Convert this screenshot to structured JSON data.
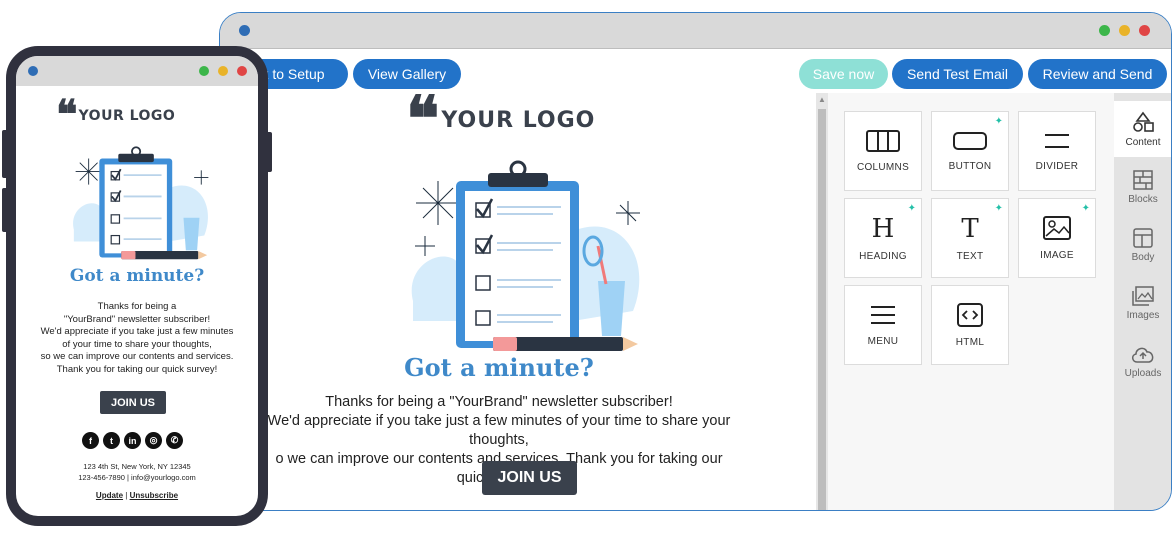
{
  "toolbar": {
    "back_label": "k to Setup",
    "gallery_label": "View Gallery",
    "save_label": "Save now",
    "test_label": "Send Test Email",
    "review_label": "Review and Send"
  },
  "email": {
    "logo_quote": "❝",
    "logo_text": "YOUR LOGO",
    "headline": "Got a minute?",
    "body_lines_desktop": [
      "Thanks for being a \"YourBrand\" newsletter subscriber!",
      "We'd appreciate if you take just a few minutes of your time to share your thoughts,",
      "o we can improve our contents and services. Thank you for taking our quick survey!"
    ],
    "body_lines_mobile": [
      "Thanks for being a",
      "\"YourBrand\" newsletter subscriber!",
      "We'd appreciate if you take just a few minutes",
      "of your time to share your thoughts,",
      "so we can improve our contents and services.",
      "Thank you for taking our quick survey!"
    ],
    "join_label": "JOIN US",
    "address_line1": "123 4th St, New York, NY 12345",
    "address_line2": "123-456-7890  |  info@yourlogo.com",
    "link_update": "Update",
    "link_separator": "|",
    "link_unsubscribe": "Unsubscribe",
    "social_icons": [
      "facebook-icon",
      "twitter-icon",
      "linkedin-icon",
      "instagram-icon",
      "whatsapp-icon"
    ]
  },
  "tools": [
    {
      "label": "COLUMNS",
      "icon": "columns-icon",
      "spark": false
    },
    {
      "label": "BUTTON",
      "icon": "button-icon",
      "spark": true
    },
    {
      "label": "DIVIDER",
      "icon": "divider-icon",
      "spark": false
    },
    {
      "label": "HEADING",
      "icon": "heading-icon",
      "spark": true
    },
    {
      "label": "TEXT",
      "icon": "text-icon",
      "spark": true
    },
    {
      "label": "IMAGE",
      "icon": "image-icon",
      "spark": true
    },
    {
      "label": "MENU",
      "icon": "menu-icon",
      "spark": false
    },
    {
      "label": "HTML",
      "icon": "html-icon",
      "spark": false
    }
  ],
  "sidenav": [
    {
      "label": "Content",
      "icon": "shapes-icon",
      "active": true
    },
    {
      "label": "Blocks",
      "icon": "blocks-icon",
      "active": false
    },
    {
      "label": "Body",
      "icon": "layout-icon",
      "active": false
    },
    {
      "label": "Images",
      "icon": "images-icon",
      "active": false
    },
    {
      "label": "Uploads",
      "icon": "cloud-upload-icon",
      "active": false
    }
  ],
  "colors": {
    "primary": "#2273c9",
    "save": "#8ee0d6",
    "headline": "#3f89c9",
    "dark": "#3a414c",
    "frame": "#30313e"
  }
}
